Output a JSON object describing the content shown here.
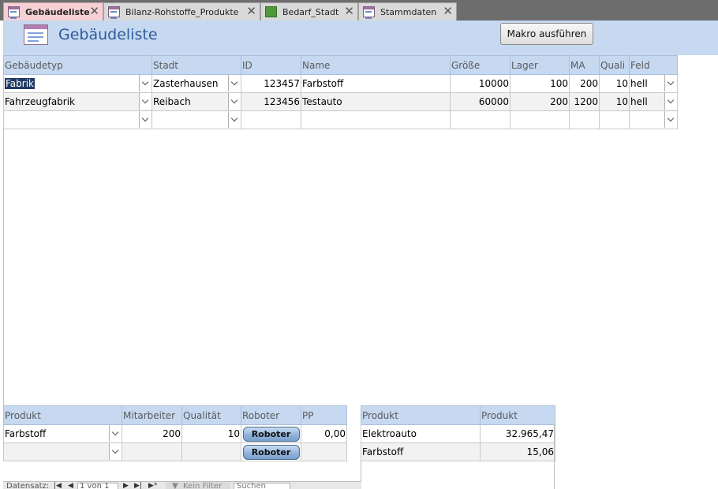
{
  "tabs": [
    {
      "label": "Gebäudeliste",
      "icon": "form-icon"
    },
    {
      "label": "Bilanz-Rohstoffe_Produkte",
      "icon": "form-icon"
    },
    {
      "label": "Bedarf_Stadt",
      "icon": "report-icon"
    },
    {
      "label": "Stammdaten",
      "icon": "form-icon"
    }
  ],
  "header": {
    "title": "Gebäudeliste",
    "macro_button": "Makro ausführen"
  },
  "main_table": {
    "columns": [
      "Gebäudetyp",
      "Stadt",
      "ID",
      "Name",
      "Größe",
      "Lager",
      "MA",
      "Quali",
      "Feld"
    ],
    "rows": [
      {
        "typ": "Fabrik",
        "stadt": "Zasterhausen",
        "id": "123457",
        "name": "Farbstoff",
        "groesse": "10000",
        "lager": "100",
        "ma": "200",
        "quali": "10",
        "feld": "hell"
      },
      {
        "typ": "Fahrzeugfabrik",
        "stadt": "Reibach",
        "id": "123456",
        "name": "Testauto",
        "groesse": "60000",
        "lager": "200",
        "ma": "1200",
        "quali": "10",
        "feld": "hell"
      }
    ]
  },
  "sub_table_left": {
    "columns": [
      "Produkt",
      "Mitarbeiter",
      "Qualität",
      "Roboter",
      "PP"
    ],
    "rows": [
      {
        "produkt": "Farbstoff",
        "mitarbeiter": "200",
        "qualitaet": "10",
        "roboter_button": "Roboter",
        "pp": "0,00"
      }
    ],
    "new_row_button": "Roboter"
  },
  "sub_table_right": {
    "columns": [
      "Produkt",
      "Produkt"
    ],
    "rows": [
      {
        "name": "Elektroauto",
        "value": "32.965,47"
      },
      {
        "name": "Farbstoff",
        "value": "15,06"
      }
    ]
  },
  "record_nav": {
    "label": "Datensatz:",
    "position": "1 von 1",
    "filter": "Kein Filter",
    "search": "Suchen"
  },
  "colors": {
    "tabbar": "#6d6d6d",
    "active_tab": "#f6d0d4",
    "header_bg": "#c6d9f1",
    "title_text": "#2e5b9a",
    "selection": "#1f3b63"
  }
}
